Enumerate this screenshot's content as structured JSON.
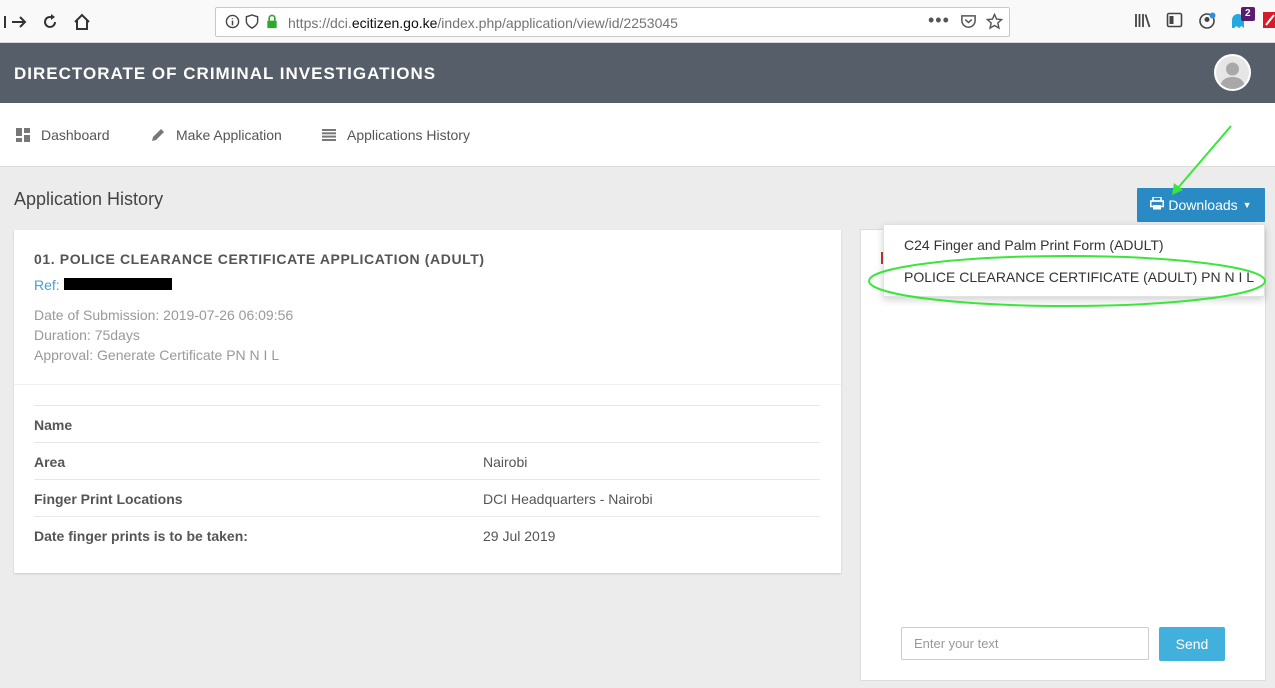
{
  "browser": {
    "url_prefix": "https://dci.",
    "url_domain": "ecitizen.go.ke",
    "url_path": "/index.php/application/view/id/2253045",
    "notification_count": "2"
  },
  "header": {
    "title": "DIRECTORATE OF CRIMINAL INVESTIGATIONS"
  },
  "nav": {
    "dashboard": "Dashboard",
    "make_application": "Make Application",
    "history": "Applications History"
  },
  "page": {
    "title": "Application History",
    "downloads_label": "Downloads"
  },
  "application": {
    "title": "01. POLICE CLEARANCE CERTIFICATE APPLICATION (ADULT)",
    "ref_label": "Ref:",
    "date_submission": "Date of Submission: 2019-07-26 06:09:56",
    "duration": "Duration: 75days",
    "approval": "Approval: Generate Certificate PN N I L",
    "details": [
      {
        "label": "Name",
        "value": ""
      },
      {
        "label": "Area",
        "value": "Nairobi"
      },
      {
        "label": "Finger Print Locations",
        "value": "DCI Headquarters - Nairobi"
      },
      {
        "label": "Date finger prints is to be taken:",
        "value": "29 Jul 2019"
      }
    ]
  },
  "downloads_menu": {
    "items": [
      {
        "label": "C24 Finger and Palm Print Form (ADULT)"
      },
      {
        "label": "POLICE CLEARANCE CERTIFICATE (ADULT) PN N I L"
      }
    ]
  },
  "chat": {
    "placeholder": "Enter your text",
    "send_label": "Send"
  },
  "colors": {
    "header_bg": "#565e69",
    "primary": "#2a8bc4",
    "send": "#42b0dc",
    "annotation": "#39e639"
  }
}
